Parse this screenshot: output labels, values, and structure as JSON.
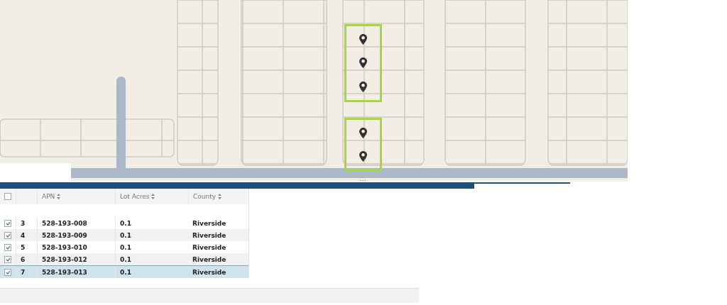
{
  "map": {
    "kind": "picture",
    "highlight_groups": [
      {
        "markers": [
          {
            "kind": "pin"
          },
          {
            "kind": "pin"
          },
          {
            "kind": "pin"
          }
        ]
      },
      {
        "markers": [
          {
            "kind": "pin"
          },
          {
            "kind": "pin"
          }
        ]
      }
    ]
  },
  "table": {
    "header_checked": false,
    "columns": [
      "APN",
      "Lot Acres",
      "County"
    ],
    "rows": [
      {
        "number": "3",
        "apn": "528-193-008",
        "lot_acres": "0.1",
        "county": "Riverside",
        "checked": true,
        "selected": false
      },
      {
        "number": "4",
        "apn": "528-193-009",
        "lot_acres": "0.1",
        "county": "Riverside",
        "checked": true,
        "selected": false
      },
      {
        "number": "5",
        "apn": "528-193-010",
        "lot_acres": "0.1",
        "county": "Riverside",
        "checked": true,
        "selected": false
      },
      {
        "number": "6",
        "apn": "528-193-012",
        "lot_acres": "0.1",
        "county": "Riverside",
        "checked": true,
        "selected": false
      },
      {
        "number": "7",
        "apn": "528-193-013",
        "lot_acres": "0.1",
        "county": "Riverside",
        "checked": true,
        "selected": true
      }
    ]
  }
}
